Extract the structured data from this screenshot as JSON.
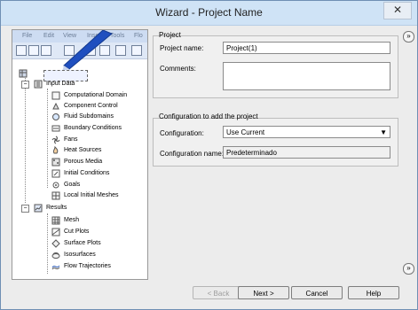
{
  "window": {
    "title": "Wizard - Project Name",
    "close_symbol": "✕"
  },
  "left_panel": {
    "fake_menu": [
      "File",
      "Edit",
      "View",
      "Insert",
      "Tools",
      "Flo"
    ],
    "tree": {
      "root_icon": "project-icon",
      "input_data": {
        "label": "Input Data",
        "items": [
          "Computational Domain",
          "Component Control",
          "Fluid Subdomains",
          "Boundary Conditions",
          "Fans",
          "Heat Sources",
          "Porous Media",
          "Initial Conditions",
          "Goals",
          "Local Initial Meshes"
        ]
      },
      "results": {
        "label": "Results",
        "items": [
          "Mesh",
          "Cut Plots",
          "Surface Plots",
          "Isosurfaces",
          "Flow Trajectories"
        ]
      }
    }
  },
  "project": {
    "section_title": "Project",
    "project_name_label": "Project name:",
    "project_name_value": "Project(1)",
    "comments_label": "Comments:",
    "comments_value": ""
  },
  "configuration": {
    "section_title": "Configuration to add the project",
    "configuration_label": "Configuration:",
    "configuration_value": "Use Current",
    "configuration_name_label": "Configuration name:",
    "configuration_name_value": "Predeterminado"
  },
  "buttons": {
    "back": "< Back",
    "next": "Next >",
    "cancel": "Cancel",
    "help": "Help"
  },
  "side_arrows": {
    "top": "»",
    "bottom": "»"
  }
}
